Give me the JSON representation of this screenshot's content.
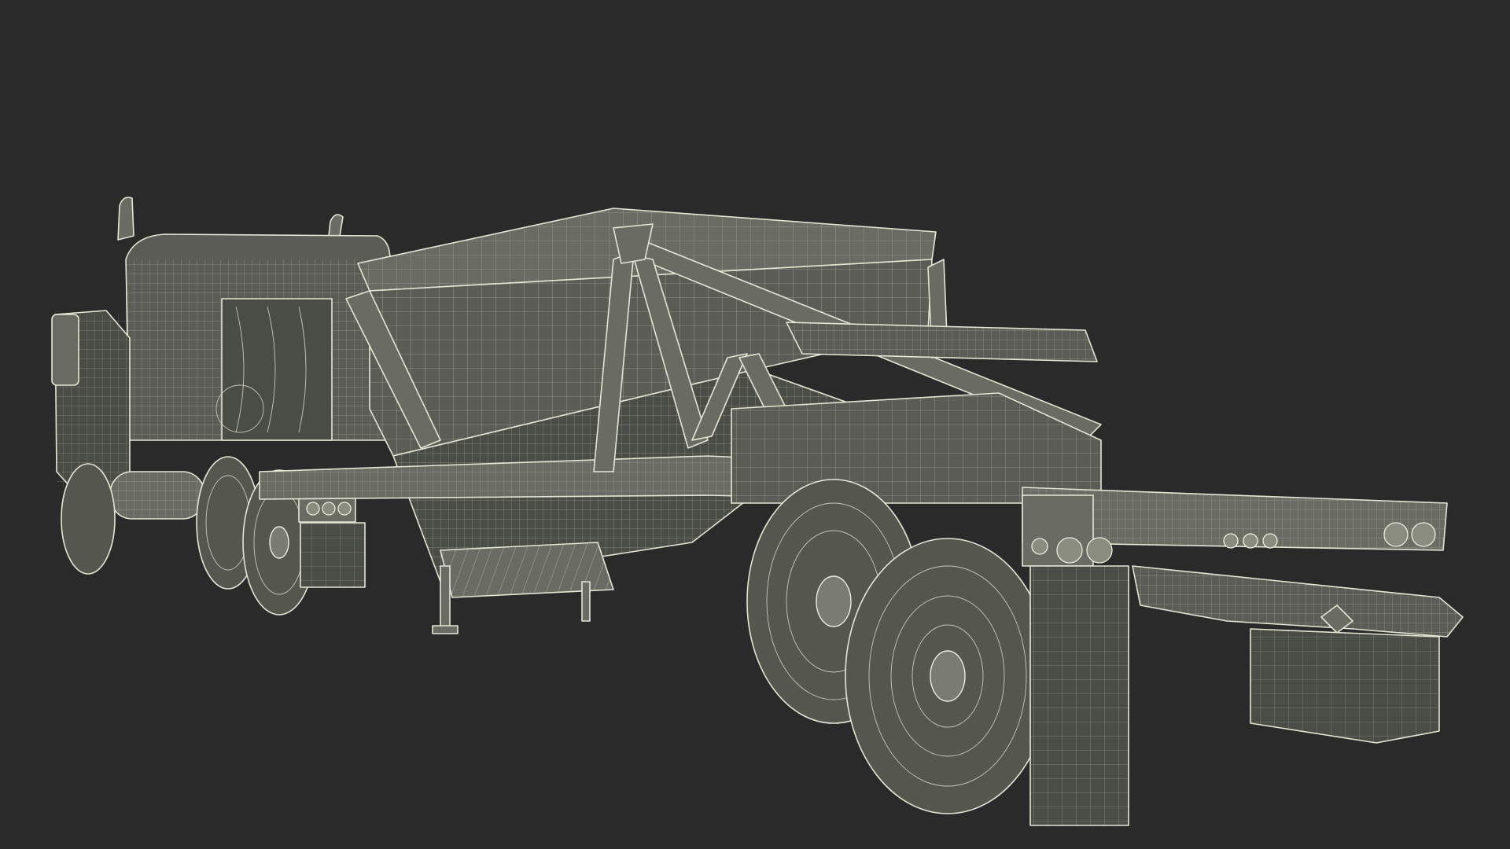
{
  "scene": {
    "subject_icon": "wireframe-bottom-dump-trailer-with-truck-icon",
    "colors": {
      "background": "#2a2a2a",
      "wire_stroke": "#e4e6d4",
      "surface_fill": "#5a5c55"
    }
  }
}
